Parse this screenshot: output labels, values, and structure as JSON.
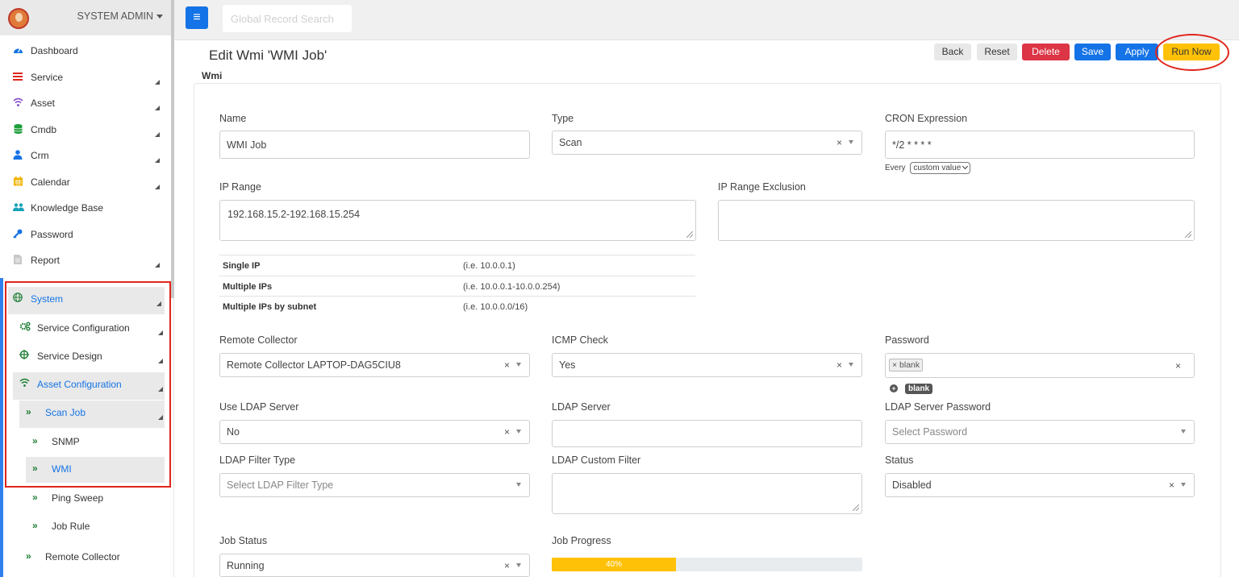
{
  "header": {
    "user_name": "SYSTEM ADMIN",
    "search_placeholder": "Global Record Search"
  },
  "sidebar": {
    "items": [
      {
        "label": "Dashboard",
        "icon": "dashboard-icon",
        "color": "#1473e6"
      },
      {
        "label": "Service",
        "icon": "list-icon",
        "color": "#e0251b"
      },
      {
        "label": "Asset",
        "icon": "wifi-icon",
        "color": "#7b3fc4"
      },
      {
        "label": "Cmdb",
        "icon": "database-icon",
        "color": "#1e9e3a"
      },
      {
        "label": "Crm",
        "icon": "user-icon",
        "color": "#1473e6"
      },
      {
        "label": "Calendar",
        "icon": "calendar-icon",
        "color": "#f0b400"
      },
      {
        "label": "Knowledge Base",
        "icon": "users-icon",
        "color": "#17a2b8"
      },
      {
        "label": "Password",
        "icon": "key-icon",
        "color": "#1473e6"
      },
      {
        "label": "Report",
        "icon": "file-icon",
        "color": "#aaaaaa"
      }
    ],
    "system": {
      "label": "System",
      "service_configuration": "Service Configuration",
      "service_design": "Service Design",
      "asset_configuration": "Asset Configuration",
      "scan_job": "Scan Job",
      "snmp": "SNMP",
      "wmi": "WMI",
      "ping_sweep": "Ping Sweep",
      "job_rule": "Job Rule",
      "remote_collector": "Remote Collector"
    }
  },
  "page": {
    "title": "Edit Wmi 'WMI Job'",
    "section": "Wmi"
  },
  "toolbar": {
    "back": "Back",
    "reset": "Reset",
    "delete": "Delete",
    "save": "Save",
    "apply": "Apply",
    "run_now": "Run Now"
  },
  "form": {
    "name": {
      "label": "Name",
      "value": "WMI Job"
    },
    "type": {
      "label": "Type",
      "value": "Scan"
    },
    "cron": {
      "label": "CRON Expression",
      "value": "*/2 * * * *",
      "every_label": "Every",
      "every_value": "custom value"
    },
    "ip_range": {
      "label": "IP Range",
      "value": "192.168.15.2-192.168.15.254"
    },
    "ip_range_exclusion": {
      "label": "IP Range Exclusion",
      "value": ""
    },
    "hints": [
      {
        "key": "Single IP",
        "value": "(i.e. 10.0.0.1)"
      },
      {
        "key": "Multiple IPs",
        "value": "(i.e. 10.0.0.1-10.0.0.254)"
      },
      {
        "key": "Multiple IPs by subnet",
        "value": "(i.e. 10.0.0.0/16)"
      }
    ],
    "remote_collector": {
      "label": "Remote Collector",
      "value": "Remote Collector LAPTOP-DAG5CIU8"
    },
    "icmp_check": {
      "label": "ICMP Check",
      "value": "Yes"
    },
    "password": {
      "label": "Password",
      "tag": "× blank",
      "badge": "blank"
    },
    "use_ldap_server": {
      "label": "Use LDAP Server",
      "value": "No"
    },
    "ldap_server": {
      "label": "LDAP Server",
      "value": ""
    },
    "ldap_server_password": {
      "label": "LDAP Server Password",
      "placeholder": "Select Password"
    },
    "ldap_filter_type": {
      "label": "LDAP Filter Type",
      "placeholder": "Select LDAP Filter Type"
    },
    "ldap_custom_filter": {
      "label": "LDAP Custom Filter",
      "value": ""
    },
    "status": {
      "label": "Status",
      "value": "Disabled"
    },
    "job_status": {
      "label": "Job Status",
      "value": "Running"
    },
    "job_progress": {
      "label": "Job Progress",
      "value_text": "40%",
      "fraction": 0.4
    }
  },
  "colors": {
    "primary": "#1473e6",
    "danger": "#dc3545",
    "warning": "#ffc107",
    "highlight": "#e0251b"
  }
}
